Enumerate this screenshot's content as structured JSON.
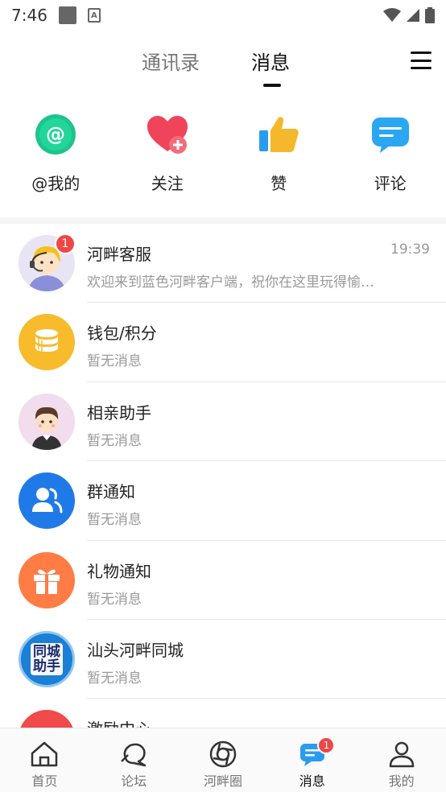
{
  "status_bar": {
    "time": "7:46"
  },
  "tabs": {
    "contacts": "通讯录",
    "messages": "消息"
  },
  "quick_actions": [
    {
      "label": "@我的",
      "icon": "at-icon"
    },
    {
      "label": "关注",
      "icon": "heart-plus-icon"
    },
    {
      "label": "赞",
      "icon": "thumbs-up-icon"
    },
    {
      "label": "评论",
      "icon": "comment-icon"
    }
  ],
  "messages": [
    {
      "title": "河畔客服",
      "subtitle": "欢迎来到蓝色河畔客户端，祝你在这里玩得愉…",
      "time": "19:39",
      "badge": "1"
    },
    {
      "title": "钱包/积分",
      "subtitle": "暂无消息"
    },
    {
      "title": "相亲助手",
      "subtitle": "暂无消息"
    },
    {
      "title": "群通知",
      "subtitle": "暂无消息"
    },
    {
      "title": "礼物通知",
      "subtitle": "暂无消息"
    },
    {
      "title": "汕头河畔同城",
      "subtitle": "暂无消息",
      "avatar_text": "同城助手"
    },
    {
      "title": "激励中心",
      "subtitle": ""
    }
  ],
  "bottom_nav": [
    {
      "label": "首页"
    },
    {
      "label": "论坛"
    },
    {
      "label": "河畔圈"
    },
    {
      "label": "消息",
      "badge": "1"
    },
    {
      "label": "我的"
    }
  ]
}
